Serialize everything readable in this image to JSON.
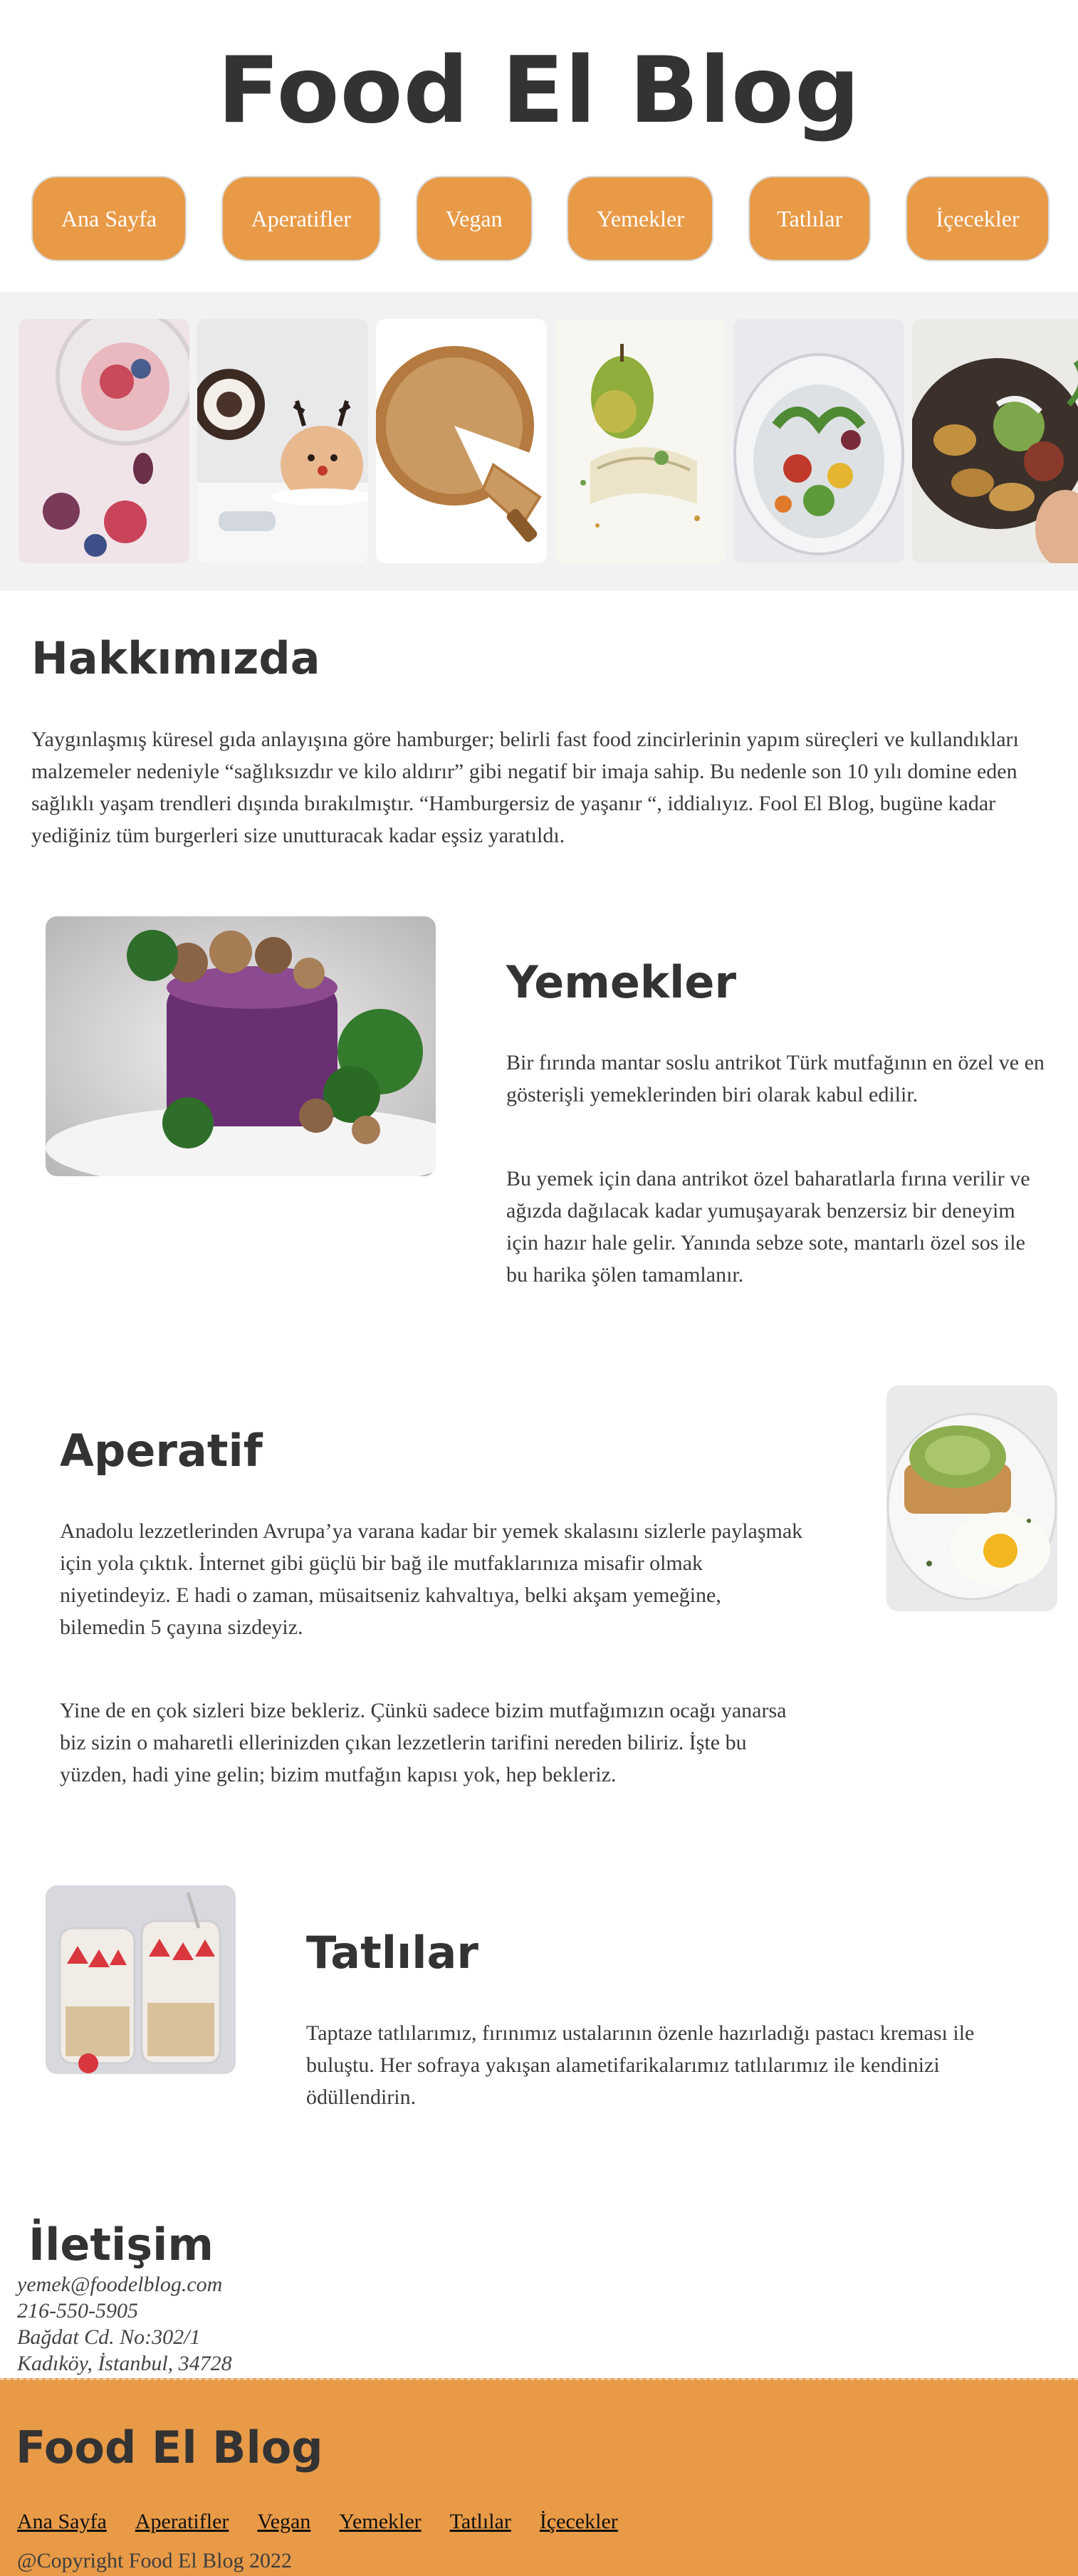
{
  "site": {
    "title": "Food El Blog"
  },
  "nav": [
    "Ana Sayfa",
    "Aperatifler",
    "Vegan",
    "Yemekler",
    "Tatlılar",
    "İçecekler"
  ],
  "gallery": [
    "fig-jar-photo",
    "cake-roll-photo",
    "pie-photo",
    "pear-dish-photo",
    "salad-bowl-photo",
    "potato-bowl-photo"
  ],
  "about": {
    "heading": "Hakkımızda",
    "text": "Yaygınlaşmış küresel gıda anlayışına göre hamburger; belirli fast food zincirlerinin yapım süreçleri ve kullandıkları malzemeler nedeniyle “sağlıksızdır ve kilo aldırır” gibi negatif bir imaja sahip. Bu nedenle son 10 yılı domine eden sağlıklı yaşam trendleri dışında bırakılmıştır. “Hamburgersiz de yaşanır “, iddialıyız. Fool El Blog, bugüne kadar yediğiniz tüm burgerleri size unutturacak kadar eşsiz yaratıldı."
  },
  "yemekler": {
    "heading": "Yemekler",
    "p1": "Bir fırında mantar soslu antrikot Türk mutfağının en özel ve en gösterişli yemeklerinden biri olarak kabul edilir.",
    "p2": "Bu yemek için dana antrikot özel baharatlarla fırına verilir ve ağızda dağılacak kadar yumuşayarak benzersiz bir deneyim için hazır hale gelir. Yanında sebze sote, mantarlı özel sos ile bu harika şölen tamamlanır."
  },
  "aperatif": {
    "heading": "Aperatif",
    "p1": "Anadolu lezzetlerinden Avrupa’ya varana kadar bir yemek skalasını sizlerle paylaşmak için yola çıktık. İnternet gibi güçlü bir bağ ile mutfaklarınıza misafir olmak niyetindeyiz. E hadi o zaman, müsaitseniz kahvaltıya, belki akşam yemeğine, bilemedin 5 çayına sizdeyiz.",
    "p2": "Yine de en çok sizleri bize bekleriz. Çünkü sadece bizim mutfağımızın ocağı yanarsa biz sizin o maharetli ellerinizden çıkan lezzetlerin tarifini nereden biliriz. İşte bu yüzden, hadi yine gelin; bizim mutfağın kapısı yok, hep bekleriz."
  },
  "tatlilar": {
    "heading": "Tatlılar",
    "p1": "Taptaze tatlılarımız, fırınımız ustalarının özenle hazırladığı pastacı kreması ile buluştu. Her sofraya yakışan alametifarikalarımız tatlılarımız ile kendinizi ödüllendirin."
  },
  "contact": {
    "heading": "İletişim",
    "email": "yemek@foodelblog.com",
    "phone": "216-550-5905",
    "address1": "Bağdat Cd. No:302/1",
    "address2": "Kadıköy, İstanbul, 34728"
  },
  "footer": {
    "title": "Food El Blog",
    "links": [
      "Ana Sayfa",
      "Aperatifler",
      "Vegan",
      "Yemekler",
      "Tatlılar",
      "İçecekler"
    ],
    "copyright": "@Copyright Food El Blog 2022"
  },
  "colors": {
    "accent": "#e89a47",
    "gallery_bg": "#f2f2f2",
    "text": "#3a3a3a"
  }
}
